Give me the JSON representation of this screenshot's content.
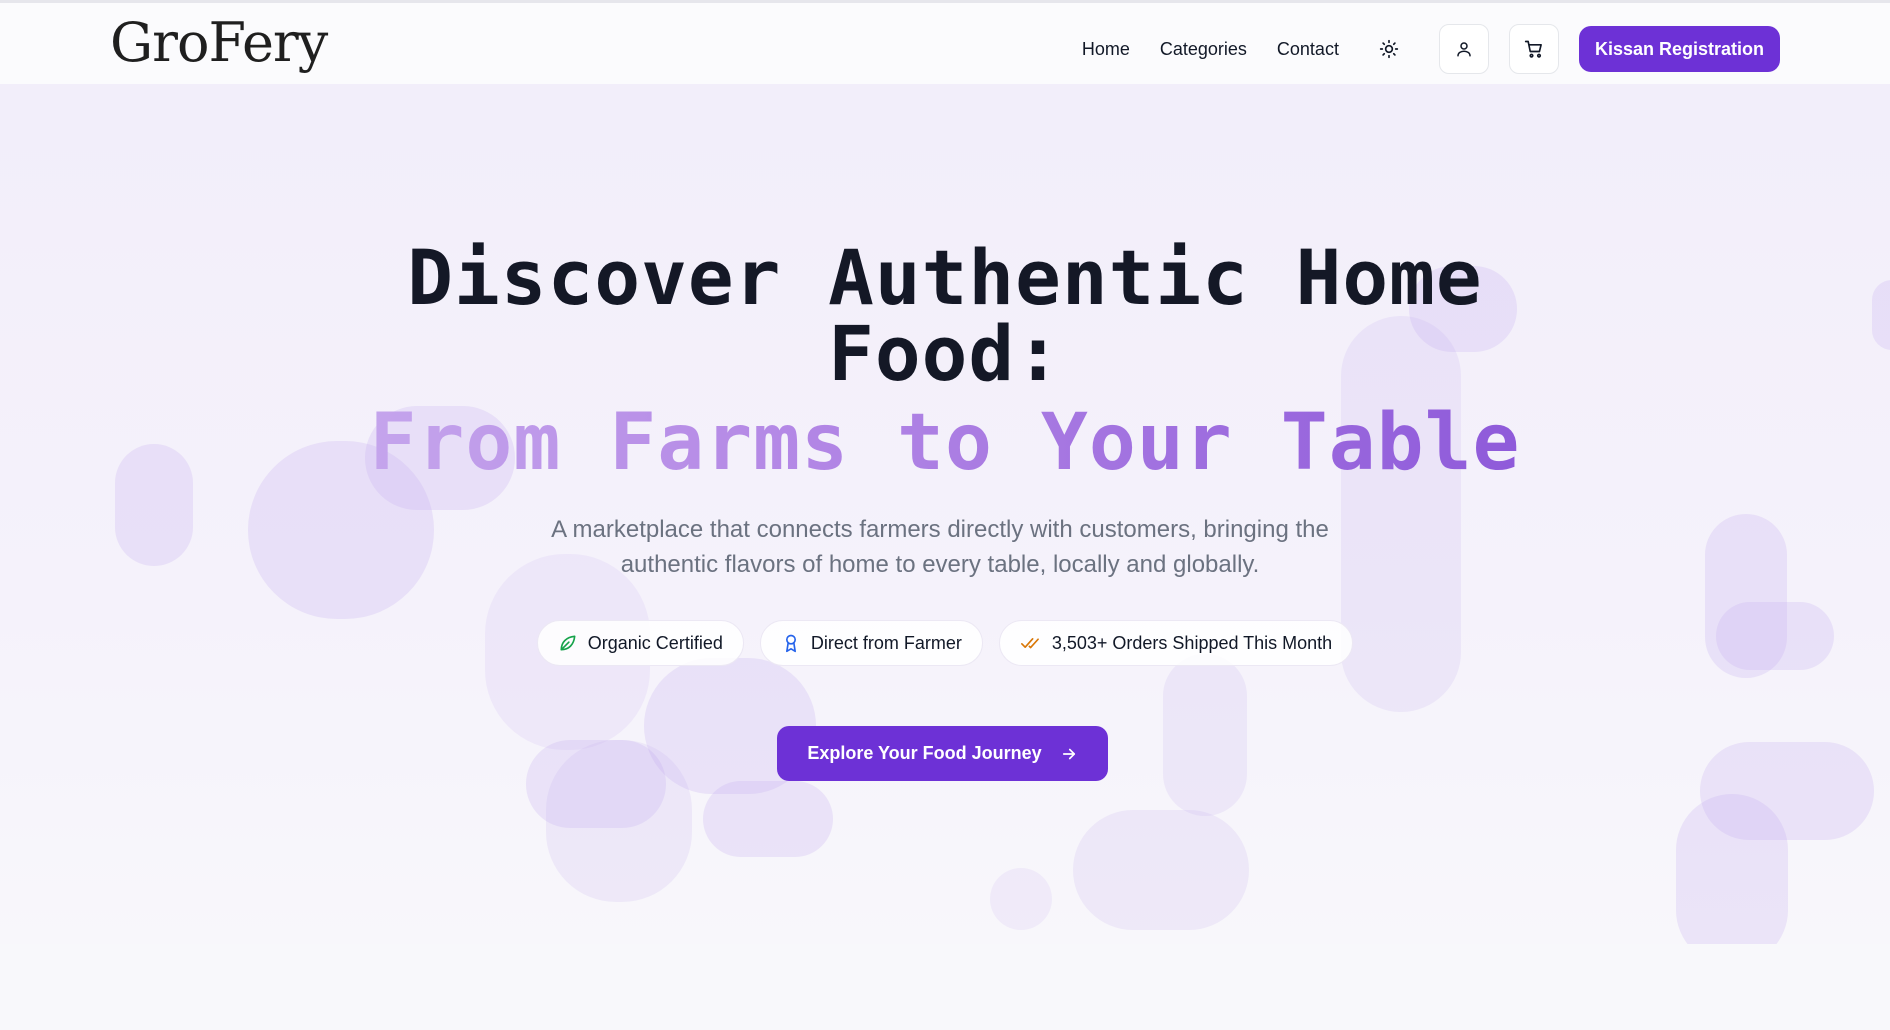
{
  "header": {
    "logo_text": "GroFery",
    "nav": {
      "home": "Home",
      "categories": "Categories",
      "contact": "Contact"
    },
    "icons": {
      "theme": "sun-icon",
      "account": "user-icon",
      "cart": "cart-icon"
    },
    "register_label": "Kissan Registration"
  },
  "hero": {
    "title_line1": "Discover Authentic Home",
    "title_line2": "Food:",
    "subtitle": "From Farms to Your Table",
    "description": "A marketplace that connects farmers directly with customers, bringing the authentic flavors of home to every table, locally and globally.",
    "badges": [
      {
        "label": "Organic Certified",
        "icon": "leaf-icon",
        "color": "#16a34a"
      },
      {
        "label": "Direct from Farmer",
        "icon": "award-icon",
        "color": "#2563eb"
      },
      {
        "label": "3,503+ Orders Shipped This Month",
        "icon": "double-check-icon",
        "color": "#d97706"
      }
    ],
    "cta_label": "Explore Your Food Journey"
  },
  "colors": {
    "accent": "#6d31d6",
    "heading": "#141826",
    "muted_text": "#6b7280"
  }
}
